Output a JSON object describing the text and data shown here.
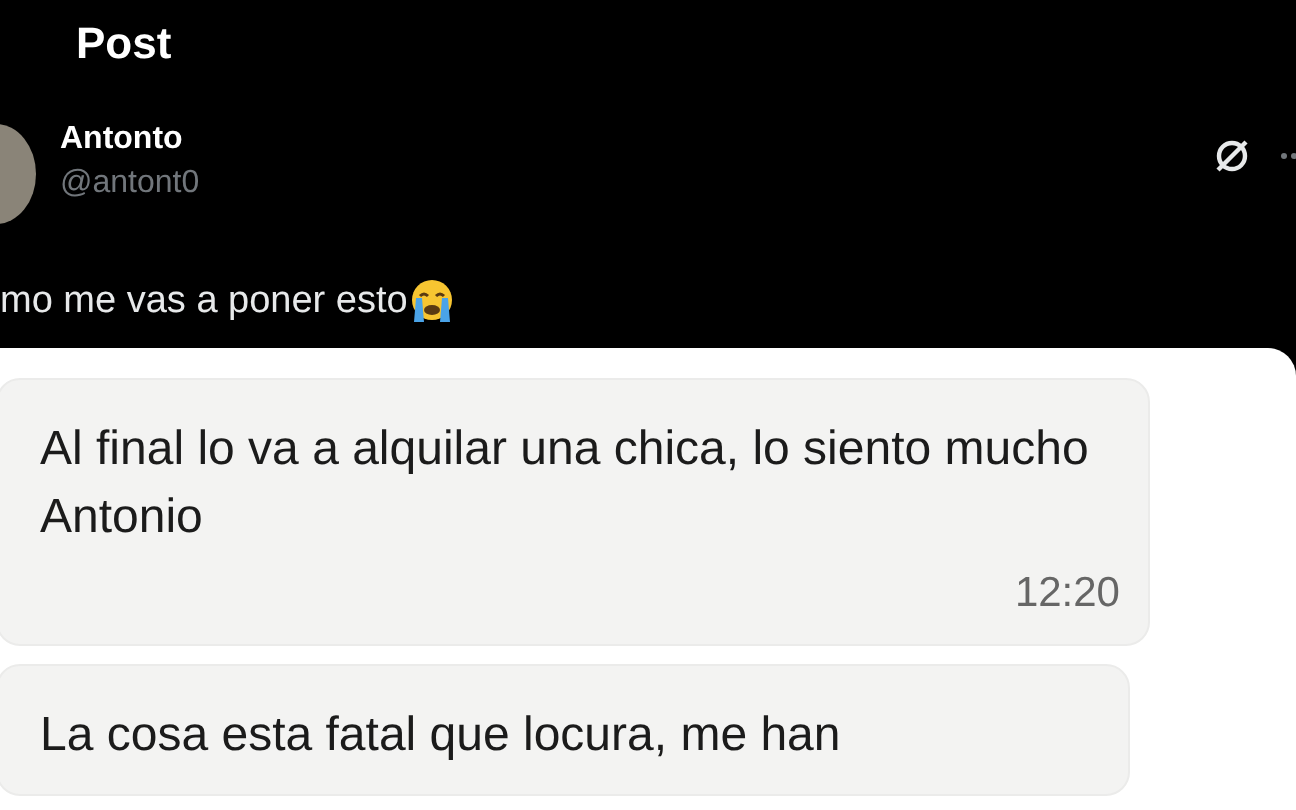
{
  "header": {
    "title": "Post"
  },
  "post": {
    "author": "Antonto",
    "handle": "@antont0",
    "text": "mo me vas a poner esto"
  },
  "image": {
    "messages": [
      {
        "text": "Al final lo va a alquilar una chica, lo siento mucho Antonio",
        "time": "12:20"
      },
      {
        "text": "La cosa esta fatal que locura, me han"
      }
    ]
  }
}
